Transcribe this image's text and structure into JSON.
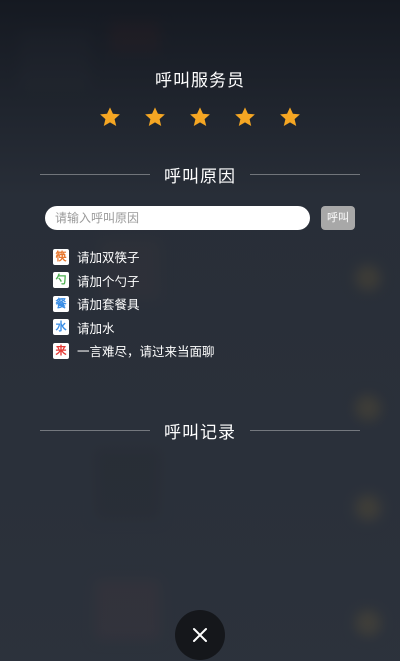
{
  "dialog": {
    "title": "呼叫服务员",
    "stars": {
      "count": 5,
      "rating": 5,
      "color": "#f5a623"
    }
  },
  "reason_section": {
    "heading": "呼叫原因",
    "input_placeholder": "请输入呼叫原因",
    "input_value": "",
    "call_button_label": "呼叫",
    "options": [
      {
        "badge": "筷",
        "badge_color": "#e8772e",
        "label": "请加双筷子"
      },
      {
        "badge": "勺",
        "badge_color": "#4caf50",
        "label": "请加个勺子"
      },
      {
        "badge": "餐",
        "badge_color": "#3a8ee6",
        "label": "请加套餐具"
      },
      {
        "badge": "水",
        "badge_color": "#3a8ee6",
        "label": "请加水"
      },
      {
        "badge": "来",
        "badge_color": "#e53935",
        "label": "一言难尽，请过来当面聊"
      }
    ]
  },
  "history_section": {
    "heading": "呼叫记录"
  },
  "close_button": {
    "icon": "close-icon"
  }
}
